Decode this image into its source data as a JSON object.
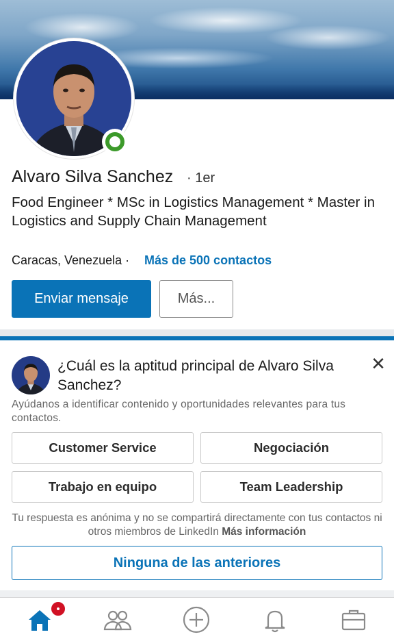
{
  "profile": {
    "name": "Alvaro Silva Sanchez",
    "degree": "· 1er",
    "headline": "Food Engineer * MSc in Logistics Management * Master in Logistics and Supply Chain Management",
    "location": "Caracas, Venezuela ·",
    "connections": "Más de 500 contactos",
    "online_status_color": "#3c9a2a"
  },
  "actions": {
    "message_label": "Enviar mensaje",
    "more_label": "Más..."
  },
  "skill_question": {
    "title": "¿Cuál es la aptitud principal de Alvaro Silva Sanchez?",
    "subtitle": "Ayúdanos a identificar contenido y oportunidades relevantes para tus contactos.",
    "options": [
      "Customer Service",
      "Negociación",
      "Trabajo en equipo",
      "Team Leadership"
    ],
    "note": "Tu respuesta es anónima y no se compartirá directamente con tus contactos ni otros miembros de LinkedIn",
    "more_info": "Más información",
    "none_label": "Ninguna de las anteriores",
    "close_icon": "close-icon"
  },
  "tabbar": {
    "items": [
      "home-icon",
      "people-icon",
      "add-post-icon",
      "notifications-icon",
      "jobs-icon"
    ],
    "active": "home-icon",
    "accent_color": "#0a73b7",
    "badge_color": "#d11124"
  }
}
